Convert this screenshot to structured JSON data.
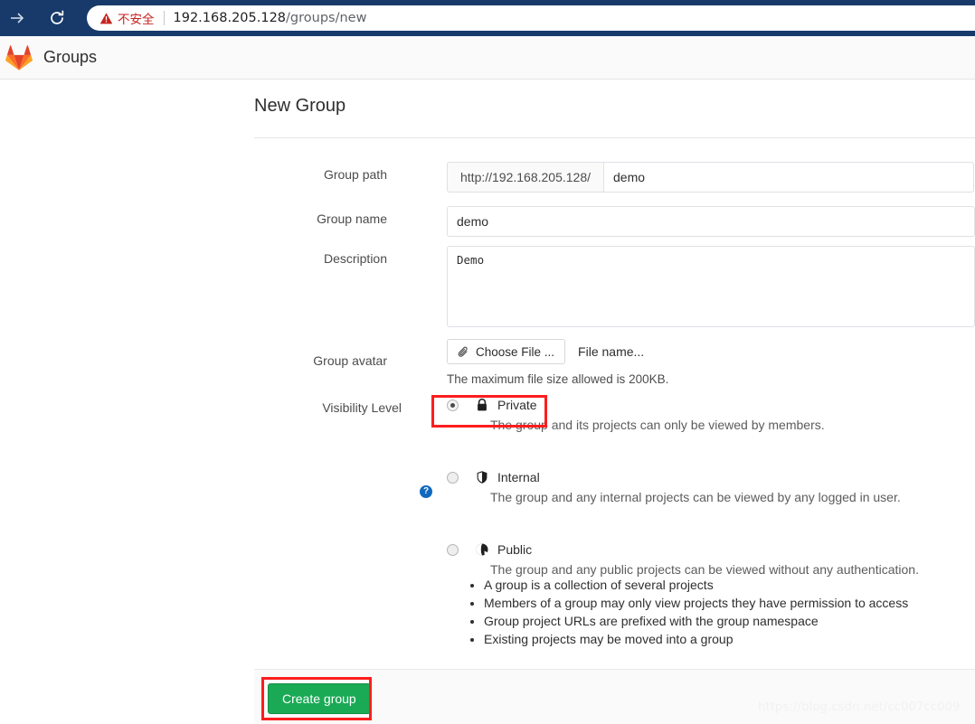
{
  "browser": {
    "forward_icon": "arrow-right-icon",
    "reload_icon": "reload-icon",
    "security_icon": "warning-triangle-icon",
    "security_label": "不安全",
    "url_host": "192.168.205.128",
    "url_path": "/groups/new"
  },
  "header": {
    "logo_icon": "gitlab-fox-logo",
    "title": "Groups"
  },
  "page": {
    "title": "New Group"
  },
  "form": {
    "group_path": {
      "label": "Group path",
      "prefix": "http://192.168.205.128/",
      "value": "demo",
      "placeholder": ""
    },
    "group_name": {
      "label": "Group name",
      "value": "demo",
      "placeholder": ""
    },
    "description": {
      "label": "Description",
      "value": "Demo",
      "placeholder": ""
    },
    "group_avatar": {
      "label": "Group avatar",
      "choose_icon": "paperclip-icon",
      "choose_label": "Choose File ...",
      "file_name": "File name...",
      "hint": "The maximum file size allowed is 200KB."
    },
    "visibility": {
      "label": "Visibility Level",
      "help_icon": "question-circle-icon",
      "help_glyph": "?",
      "options": [
        {
          "name": "Private",
          "icon": "lock-icon",
          "description": "The group and its projects can only be viewed by members.",
          "selected": true
        },
        {
          "name": "Internal",
          "icon": "shield-icon",
          "description": "The group and any internal projects can be viewed by any logged in user.",
          "selected": false
        },
        {
          "name": "Public",
          "icon": "globe-icon",
          "description": "The group and any public projects can be viewed without any authentication.",
          "selected": false
        }
      ]
    },
    "bullets": [
      "A group is a collection of several projects",
      "Members of a group may only view projects they have permission to access",
      "Group project URLs are prefixed with the group namespace",
      "Existing projects may be moved into a group"
    ],
    "submit_label": "Create group"
  },
  "watermark": "https://blog.csdn.net/cc007cc009",
  "colors": {
    "browser_bar": "#173a6a",
    "insecure_text": "#c5221f",
    "gitlab_orange": "#fc6d26",
    "primary_green": "#1aaa55",
    "highlight_red": "#fd1d1d",
    "help_blue": "#1068bf"
  }
}
